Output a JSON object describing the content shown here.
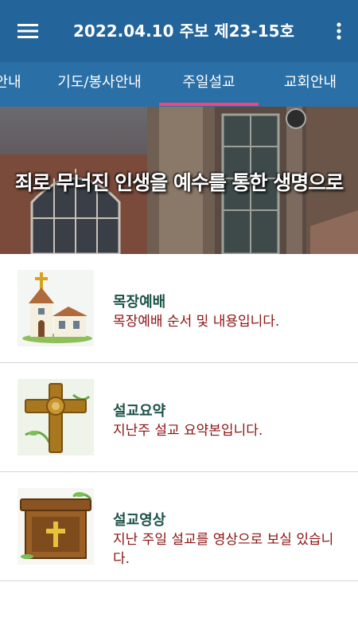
{
  "appbar": {
    "title": "2022.04.10 주보 제23-15호"
  },
  "tabs": [
    {
      "label": "안내"
    },
    {
      "label": "기도/봉사안내"
    },
    {
      "label": "주일설교"
    },
    {
      "label": "교회안내"
    }
  ],
  "banner": {
    "text": "죄로 무너진 인생을 예수를 통한 생명으로"
  },
  "items": [
    {
      "title": "목장예배",
      "desc": "목장예배 순서 및 내용입니다.",
      "icon": "church-icon"
    },
    {
      "title": "설교요약",
      "desc": "지난주 설교 요약본입니다.",
      "icon": "cross-icon"
    },
    {
      "title": "설교영상",
      "desc": "지난 주일 설교를 영상으로 보실 있습니다.",
      "icon": "pulpit-icon"
    }
  ],
  "colors": {
    "appbar": "#23649a",
    "tabbar": "#2a6fa6",
    "indicator": "#f0457e",
    "title": "#1c5247",
    "desc": "#8c1212"
  }
}
